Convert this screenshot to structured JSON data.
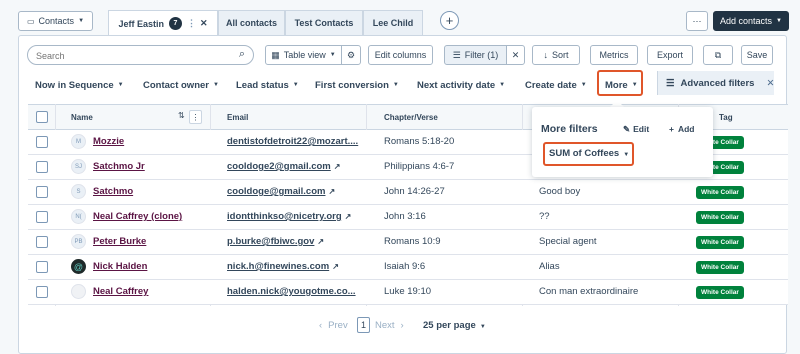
{
  "header": {
    "object_selector": "Contacts",
    "tabs": [
      {
        "label": "Jeff Eastin",
        "count": "7"
      },
      {
        "label": "All contacts"
      },
      {
        "label": "Test Contacts"
      },
      {
        "label": "Lee Child"
      }
    ],
    "more_menu": "⋯",
    "add_contacts": "Add contacts"
  },
  "toolbar": {
    "search_placeholder": "Search",
    "table_view": "Table view",
    "edit_columns": "Edit columns",
    "filter": "Filter (1)",
    "sort": "Sort",
    "metrics": "Metrics",
    "export": "Export",
    "save": "Save"
  },
  "filters": {
    "items": [
      "Now in Sequence",
      "Contact owner",
      "Lead status",
      "First conversion",
      "Next activity date",
      "Create date",
      "More"
    ],
    "advanced": "Advanced filters"
  },
  "table": {
    "columns": [
      "Name",
      "Email",
      "Chapter/Verse",
      "Tag"
    ],
    "rows": [
      {
        "initials": "M",
        "name": "Mozzie",
        "email": "dentistofdetroit22@mozart....",
        "verse": "Romans 5:18-20",
        "note": "",
        "tag": "White Collar"
      },
      {
        "initials": "SJ",
        "name": "Satchmo Jr",
        "email": "cooldoge2@gmail.com",
        "verse": "Philippians 4:6-7",
        "note": "",
        "tag": "White Collar"
      },
      {
        "initials": "S",
        "name": "Satchmo",
        "email": "cooldoge@gmail.com",
        "verse": "John 14:26-27",
        "note": "Good boy",
        "tag": "White Collar"
      },
      {
        "initials": "N(",
        "name": "Neal Caffrey (clone)",
        "email": "idontthinkso@nicetry.org",
        "verse": "John 3:16",
        "note": "??",
        "tag": "White Collar"
      },
      {
        "initials": "PB",
        "name": "Peter Burke",
        "email": "p.burke@fbiwc.gov",
        "verse": "Romans 10:9",
        "note": "Special agent",
        "tag": "White Collar"
      },
      {
        "initials": "",
        "name": "Nick Halden",
        "email": "nick.h@finewines.com",
        "verse": "Isaiah 9:6",
        "note": "Alias",
        "tag": "White Collar"
      },
      {
        "initials": "",
        "name": "Neal Caffrey",
        "email": "halden.nick@yougotme.co...",
        "verse": "Luke 19:10",
        "note": "Con man extraordinaire",
        "tag": "White Collar"
      }
    ]
  },
  "popover": {
    "title": "More filters",
    "edit": "Edit",
    "add": "Add",
    "filter_chip": "SUM of Coffees"
  },
  "pagination": {
    "prev": "Prev",
    "page": "1",
    "next": "Next",
    "per_page": "25 per page"
  },
  "colors": {
    "accent_orange": "#e0562a",
    "tag_green": "#00823c",
    "dark_button": "#213343",
    "name_link": "#5b1444"
  }
}
